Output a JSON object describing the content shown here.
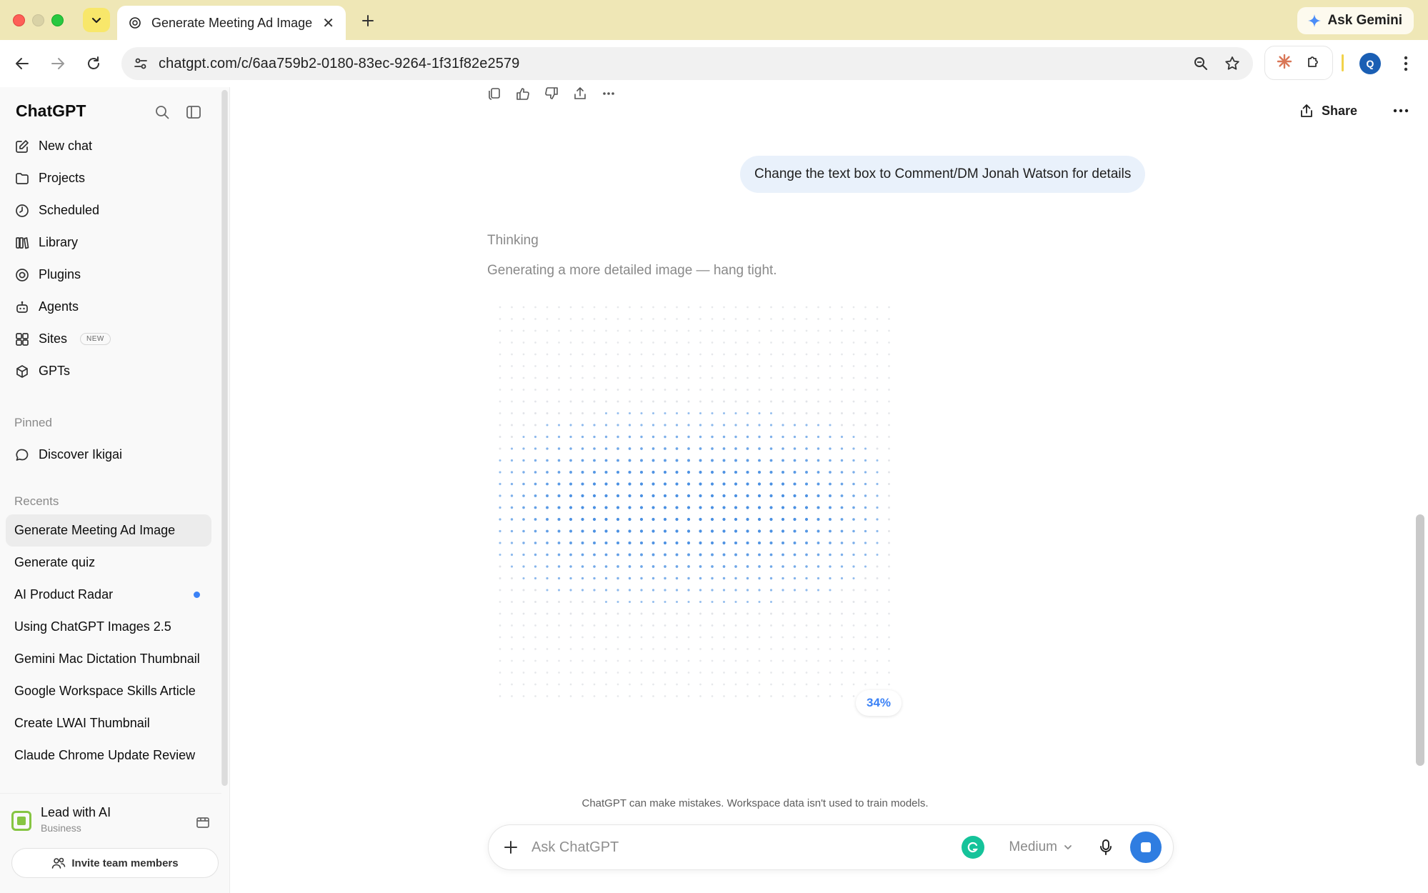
{
  "browser": {
    "tab_title": "Generate Meeting Ad Image",
    "url": "chatgpt.com/c/6aa759b2-0180-83ec-9264-1f31f82e2579",
    "ask_gemini_label": "Ask Gemini",
    "profile_initial": "Q"
  },
  "sidebar": {
    "brand": "ChatGPT",
    "nav": [
      {
        "label": "New chat",
        "icon": "edit-icon"
      },
      {
        "label": "Projects",
        "icon": "folder-icon"
      },
      {
        "label": "Scheduled",
        "icon": "clock-icon"
      },
      {
        "label": "Library",
        "icon": "library-icon"
      },
      {
        "label": "Plugins",
        "icon": "plugin-icon"
      },
      {
        "label": "Agents",
        "icon": "agent-icon"
      },
      {
        "label": "Sites",
        "icon": "sites-icon",
        "badge": "NEW"
      },
      {
        "label": "GPTs",
        "icon": "cube-icon"
      }
    ],
    "pinned_label": "Pinned",
    "pinned": [
      {
        "label": "Discover Ikigai",
        "icon": "chat-bubble-icon"
      }
    ],
    "recents_label": "Recents",
    "recents": [
      {
        "label": "Generate Meeting Ad Image",
        "active": true
      },
      {
        "label": "Generate quiz"
      },
      {
        "label": "AI Product Radar",
        "unread": true
      },
      {
        "label": "Using ChatGPT Images 2.5"
      },
      {
        "label": "Gemini Mac Dictation Thumbnail"
      },
      {
        "label": "Google Workspace Skills Article"
      },
      {
        "label": "Create LWAI Thumbnail"
      },
      {
        "label": "Claude Chrome Update Review"
      }
    ],
    "workspace": {
      "name": "Lead with AI",
      "plan": "Business",
      "invite_label": "Invite team members"
    }
  },
  "chat": {
    "share_label": "Share",
    "user_message": "Change the text box to Comment/DM Jonah Watson for details",
    "thinking_label": "Thinking",
    "status_text": "Generating a more detailed image — hang tight.",
    "progress_label": "34%",
    "progress": 0.34,
    "disclaimer": "ChatGPT can make mistakes. Workspace data isn't used to train models.",
    "composer": {
      "placeholder": "Ask ChatGPT",
      "model": "Medium"
    }
  },
  "colors": {
    "accent": "#2f7de1",
    "bubble": "#e9f1fb",
    "tabbar": "#efe7b6",
    "unread": "#3b82f6"
  }
}
